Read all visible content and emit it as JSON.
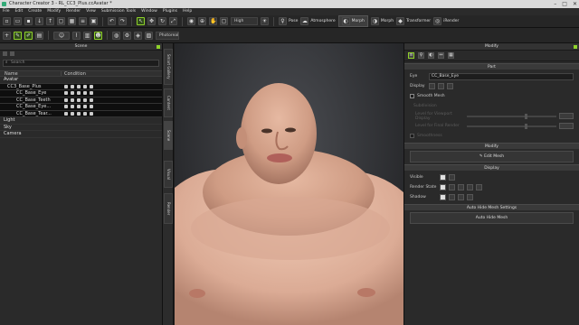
{
  "window": {
    "title": "Character Creator 3 - RL_CC3_Plus.ccAvatar *",
    "controls": [
      "–",
      "□",
      "✕"
    ]
  },
  "menu": [
    "File",
    "Edit",
    "Create",
    "Modify",
    "Render",
    "View",
    "Submission Tools",
    "Window",
    "Plugins",
    "Help"
  ],
  "toolbar": {
    "quality": "High",
    "pose": "Pose",
    "atmosphere": "Atmosphere",
    "morph": "Morph",
    "morph2": "Morph",
    "transformer": "Transformer",
    "irender": "iRender",
    "render_mode": "Photoreal"
  },
  "scene": {
    "title": "Scene",
    "search_placeholder": "Search",
    "col_name": "Name",
    "col_condition": "Condition",
    "rows": [
      {
        "name": "Avatar",
        "indent": 4
      },
      {
        "name": "CC3_Base_Plus",
        "indent": 8
      },
      {
        "name": "CC_Base_Eye",
        "indent": 18
      },
      {
        "name": "CC_Base_Teeth",
        "indent": 18
      },
      {
        "name": "CC_Base_Eye...",
        "indent": 18
      },
      {
        "name": "CC_Base_Tear...",
        "indent": 18
      },
      {
        "name": "Light",
        "indent": 4
      },
      {
        "name": "Sky",
        "indent": 4
      },
      {
        "name": "Camera",
        "indent": 4
      }
    ],
    "side_tabs": [
      "Smart Gallery",
      "Content",
      "Scene",
      "Visual",
      "Render"
    ]
  },
  "modify": {
    "title": "Modify",
    "part_section": "Part",
    "eye_label": "Eye",
    "eye_value": "CC_Base_Eye",
    "display_label": "Display",
    "smooth_mesh": "Smooth Mesh",
    "subdivision": "Subdivision",
    "level_viewport": "Level for Viewport Display",
    "level_render": "Level for Final Render",
    "ssm": "Smoothness",
    "modify_section": "Modify",
    "edit_mesh": "Edit Mesh",
    "display_section": "Display",
    "visible_label": "Visible",
    "render_state_label": "Render State",
    "shadow_label": "Shadow",
    "autohide_section": "Auto Hide Mesh Settings",
    "autohide_button": "Auto Hide Mesh"
  }
}
